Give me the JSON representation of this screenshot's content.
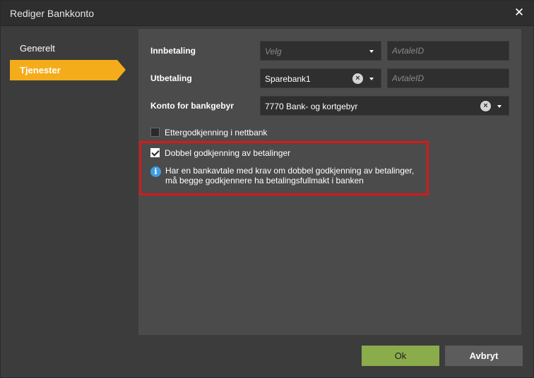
{
  "dialog": {
    "title": "Rediger Bankkonto",
    "close_symbol": "✕"
  },
  "nav": {
    "items": [
      {
        "label": "Generelt",
        "active": false
      },
      {
        "label": "Tjenester",
        "active": true
      }
    ]
  },
  "form": {
    "innbetaling": {
      "label": "Innbetaling",
      "select_placeholder": "Velg",
      "avtale_placeholder": "AvtaleID"
    },
    "utbetaling": {
      "label": "Utbetaling",
      "select_value": "Sparebank1",
      "avtale_placeholder": "AvtaleID"
    },
    "bankgebyr": {
      "label": "Konto for bankgebyr",
      "select_value": "7770 Bank- og kortgebyr"
    },
    "ettergodkjenning": {
      "label": "Ettergodkjenning i nettbank",
      "checked": false
    },
    "dobbel_godkjenning": {
      "label": "Dobbel godkjenning av betalinger",
      "checked": true
    },
    "info": {
      "icon_glyph": "i",
      "text": "Har en bankavtale med krav om dobbel godkjenning av betalinger, må begge godkjennere ha betalingsfullmakt i banken"
    }
  },
  "buttons": {
    "ok": "Ok",
    "cancel": "Avbryt"
  },
  "colors": {
    "accent_orange": "#f5ac1a",
    "ok_green": "#8aac4a",
    "highlight_red": "#d81818",
    "info_blue": "#3f9ee0"
  }
}
